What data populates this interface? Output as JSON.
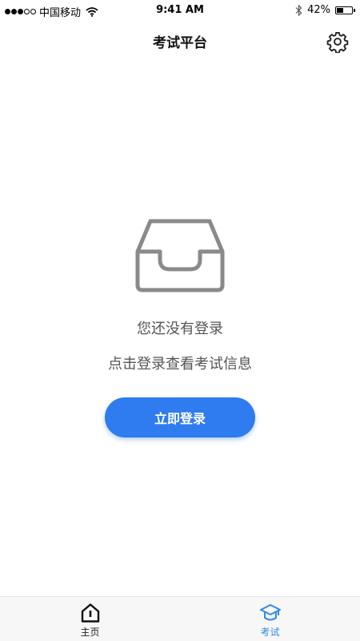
{
  "status_bar": {
    "carrier": "中国移动",
    "time": "9:41 AM",
    "battery_percent": "42%",
    "battery_level": 0.42,
    "signal_bars_filled": 3,
    "signal_bars_total": 5
  },
  "nav": {
    "title": "考试平台",
    "settings_icon": "gear-icon"
  },
  "empty_state": {
    "icon": "inbox-icon",
    "title": "您还没有登录",
    "subtitle": "点击登录查看考试信息",
    "login_button": "立即登录"
  },
  "tabs": [
    {
      "label": "主页",
      "icon": "home-icon",
      "active": false
    },
    {
      "label": "考试",
      "icon": "graduation-cap-icon",
      "active": true
    }
  ],
  "colors": {
    "accent": "#2F7BF0",
    "active_tab": "#2F8BE6",
    "muted_text": "#555555",
    "icon_gray": "#8a8a8a"
  }
}
